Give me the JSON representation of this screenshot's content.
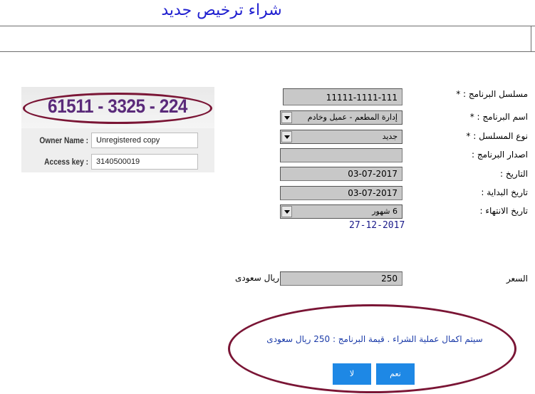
{
  "header": {
    "title": "شراء ترخيص جديد"
  },
  "registration_image": {
    "code": "61511 - 3325 - 224",
    "owner_label": "Owner Name :",
    "owner_value": "Unregistered copy",
    "access_label": "Access key :",
    "access_value": "3140500019"
  },
  "form": {
    "serial": {
      "label": "مسلسل البرنامج :  *",
      "value": "11111-1111-111"
    },
    "program_name": {
      "label": "اسم البرنامج :   *",
      "value": "إدارة المطعم - عميل وخادم"
    },
    "serial_type": {
      "label": "نوع المسلسل :   *",
      "value": "جديد"
    },
    "program_version": {
      "label": "اصدار البرنامج :",
      "value": ""
    },
    "date": {
      "label": "التاريخ :",
      "value": "03-07-2017"
    },
    "start_date": {
      "label": "تاريخ البداية :",
      "value": "03-07-2017"
    },
    "end_date": {
      "label": "تاريخ الانتهاء :",
      "value": "6 شهور",
      "computed": "27-12-2017"
    },
    "price": {
      "label": "السعر",
      "value": "250",
      "currency": "ريال سعودى"
    }
  },
  "confirm": {
    "message": "سيتم اكمال عملية الشراء . قيمة البرنامج : 250 ريال سعودى",
    "yes_label": "نعم",
    "no_label": "لا",
    "accent": "#1e88e5"
  }
}
